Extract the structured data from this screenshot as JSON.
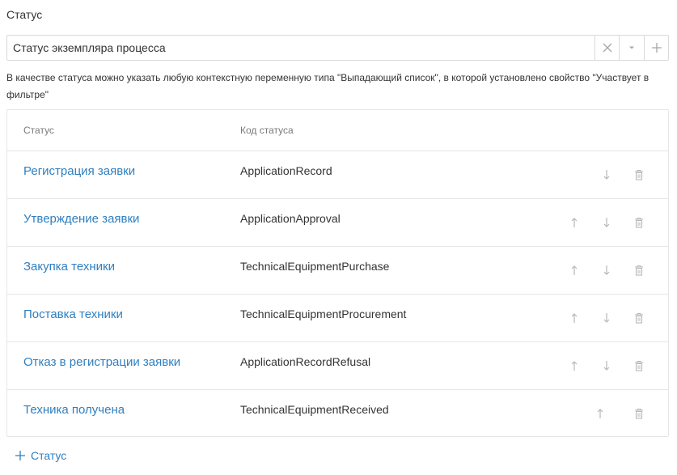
{
  "section": {
    "label": "Статус"
  },
  "status_select": {
    "value": "Статус экземпляра процесса"
  },
  "hint": "В качестве статуса можно указать любую контекстную переменную типа \"Выпадающий список\", в которой установлено свойство \"Участвует в фильтре\"",
  "table": {
    "headers": {
      "name": "Статус",
      "code": "Код статуса"
    },
    "rows": [
      {
        "name": "Регистрация заявки",
        "code": "ApplicationRecord",
        "up": false,
        "down": true
      },
      {
        "name": "Утверждение заявки",
        "code": "ApplicationApproval",
        "up": true,
        "down": true
      },
      {
        "name": "Закупка техники",
        "code": "TechnicalEquipmentPurchase",
        "up": true,
        "down": true
      },
      {
        "name": "Поставка техники",
        "code": "TechnicalEquipmentProcurement",
        "up": true,
        "down": true
      },
      {
        "name": "Отказ в регистрации заявки",
        "code": "ApplicationRecordRefusal",
        "up": true,
        "down": true
      },
      {
        "name": "Техника получена",
        "code": "TechnicalEquipmentReceived",
        "up": true,
        "down": false
      }
    ]
  },
  "add_button": {
    "label": "Статус"
  },
  "icons": {
    "clear": "close-icon",
    "dropdown": "caret-down-icon",
    "add": "plus-icon",
    "up": "arrow-up-icon",
    "down": "arrow-down-icon",
    "delete": "trash-icon"
  },
  "colors": {
    "link": "#2f7fbf",
    "icon": "#b3b3b3",
    "border": "#e6e6e6"
  }
}
